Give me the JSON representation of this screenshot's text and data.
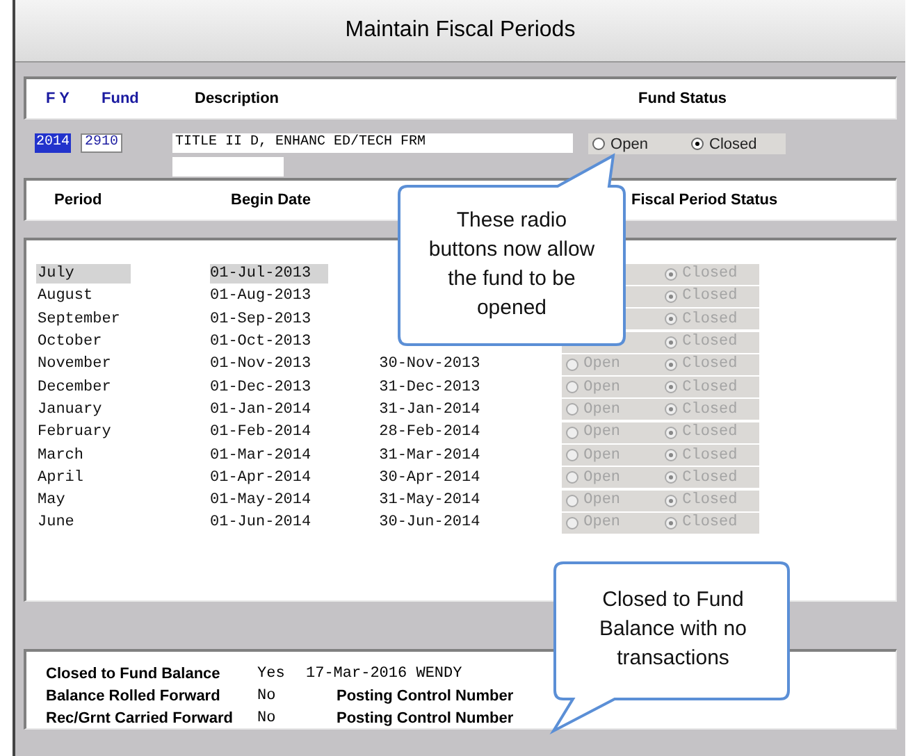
{
  "window": {
    "title": "Maintain Fiscal Periods"
  },
  "fund_columns": [
    "F Y",
    "Fund",
    "Description",
    "Fund Status"
  ],
  "fund": {
    "fy": "2014",
    "fy_selected": true,
    "fund": "2910",
    "description": "TITLE II D, ENHANC ED/TECH FRM",
    "status_options": [
      {
        "label": "Open",
        "selected": false
      },
      {
        "label": "Closed",
        "selected": true
      }
    ]
  },
  "period_columns": [
    "Period",
    "Begin Date",
    "Fiscal Period Status"
  ],
  "periods": [
    {
      "period": "July",
      "begin_date": "01-Jul-2013",
      "highlighted": true,
      "status_options": [
        {
          "label": "Closed",
          "selected": true
        }
      ]
    },
    {
      "period": "August",
      "begin_date": "01-Aug-2013",
      "highlighted": false,
      "status_options": [
        {
          "label": "Closed",
          "selected": true
        }
      ]
    },
    {
      "period": "September",
      "begin_date": "01-Sep-2013",
      "highlighted": false,
      "status_options": [
        {
          "label": "Closed",
          "selected": true
        }
      ]
    },
    {
      "period": "October",
      "begin_date": "01-Oct-2013",
      "highlighted": false,
      "status_options": [
        {
          "label": "Closed",
          "selected": true
        }
      ]
    },
    {
      "period": "November",
      "begin_date": "01-Nov-2013",
      "end_date": "30-Nov-2013",
      "highlighted": false,
      "status_options": [
        {
          "label": "Open",
          "selected": false
        },
        {
          "label": "Closed",
          "selected": true
        }
      ]
    },
    {
      "period": "December",
      "begin_date": "01-Dec-2013",
      "end_date": "31-Dec-2013",
      "highlighted": false,
      "status_options": [
        {
          "label": "Open",
          "selected": false
        },
        {
          "label": "Closed",
          "selected": true
        }
      ]
    },
    {
      "period": "January",
      "begin_date": "01-Jan-2014",
      "end_date": "31-Jan-2014",
      "highlighted": false,
      "status_options": [
        {
          "label": "Open",
          "selected": false
        },
        {
          "label": "Closed",
          "selected": true
        }
      ]
    },
    {
      "period": "February",
      "begin_date": "01-Feb-2014",
      "end_date": "28-Feb-2014",
      "highlighted": false,
      "status_options": [
        {
          "label": "Open",
          "selected": false
        },
        {
          "label": "Closed",
          "selected": true
        }
      ]
    },
    {
      "period": "March",
      "begin_date": "01-Mar-2014",
      "end_date": "31-Mar-2014",
      "highlighted": false,
      "status_options": [
        {
          "label": "Open",
          "selected": false
        },
        {
          "label": "Closed",
          "selected": true
        }
      ]
    },
    {
      "period": "April",
      "begin_date": "01-Apr-2014",
      "end_date": "30-Apr-2014",
      "highlighted": false,
      "status_options": [
        {
          "label": "Open",
          "selected": false
        },
        {
          "label": "Closed",
          "selected": true
        }
      ]
    },
    {
      "period": "May",
      "begin_date": "01-May-2014",
      "end_date": "31-May-2014",
      "highlighted": false,
      "status_options": [
        {
          "label": "Open",
          "selected": false
        },
        {
          "label": "Closed",
          "selected": true
        }
      ]
    },
    {
      "period": "June",
      "begin_date": "01-Jun-2014",
      "end_date": "30-Jun-2014",
      "highlighted": false,
      "status_options": [
        {
          "label": "Open",
          "selected": false
        },
        {
          "label": "Closed",
          "selected": true
        }
      ]
    }
  ],
  "summary": [
    {
      "label": "Closed to Fund Balance",
      "value": "Yes",
      "kind": "text",
      "detail": "17-Mar-2016 WENDY"
    },
    {
      "label": "Balance Rolled Forward",
      "value": "No",
      "kind": "field",
      "detail": "Posting Control Number"
    },
    {
      "label": "Rec/Grnt Carried Forward",
      "value": "No",
      "kind": "field",
      "detail": "Posting Control Number"
    }
  ],
  "callouts": [
    {
      "text": "These radio buttons now allow the fund to be opened"
    },
    {
      "text": "Closed to Fund Balance with no transactions"
    }
  ]
}
